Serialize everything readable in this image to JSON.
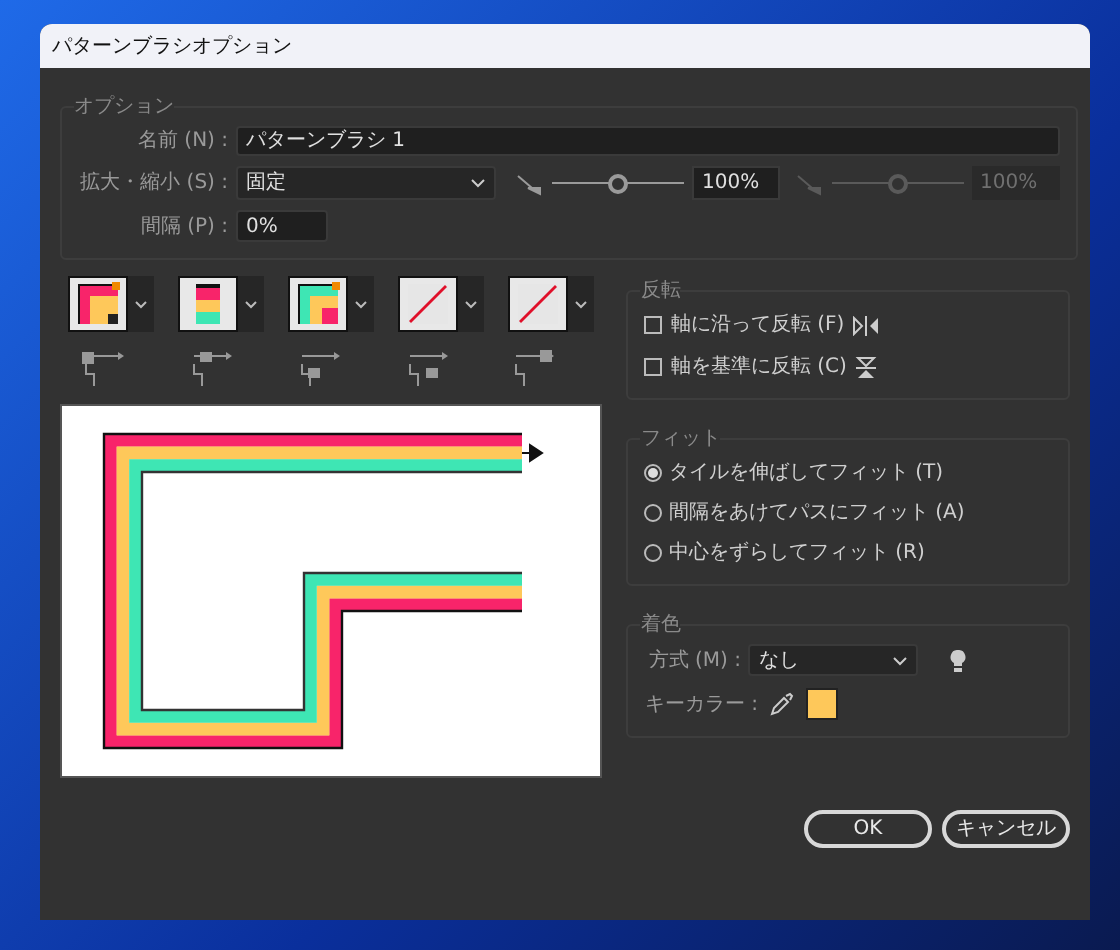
{
  "window": {
    "title": "パターンブラシオプション"
  },
  "options": {
    "legend": "オプション",
    "name": {
      "label": "名前 (N) :",
      "value": "パターンブラシ 1"
    },
    "scale": {
      "label": "拡大・縮小 (S) :",
      "value": "固定",
      "slider": {
        "level": 0.5,
        "value": "100%",
        "disabled": false
      },
      "slider_2": {
        "level": 0.5,
        "value": "100%",
        "disabled": true
      }
    },
    "spacing": {
      "label": "間隔 (P) :",
      "value": "0%"
    }
  },
  "tiles": [
    {
      "kind": "outer-corner"
    },
    {
      "kind": "side"
    },
    {
      "kind": "inner-corner"
    },
    {
      "kind": "none"
    },
    {
      "kind": "none"
    }
  ],
  "flip": {
    "legend": "反転",
    "options": [
      {
        "label": "軸に沿って反転 (F)",
        "checked": false,
        "kind": "along"
      },
      {
        "label": "軸を基準に反転 (C)",
        "checked": false,
        "kind": "across"
      }
    ]
  },
  "fit": {
    "legend": "フィット",
    "options": [
      {
        "label": "タイルを伸ばしてフィット (T)",
        "selected": true
      },
      {
        "label": "間隔をあけてパスにフィット (A)",
        "selected": false
      },
      {
        "label": "中心をずらしてフィット (R)",
        "selected": false
      }
    ]
  },
  "colorization": {
    "legend": "着色",
    "method": {
      "label": "方式 (M) :",
      "value": "なし"
    },
    "key_color": {
      "label": "キーカラー :",
      "color": "#fec85a"
    }
  },
  "buttons": [
    {
      "label": "OK"
    },
    {
      "label": "キャンセル"
    }
  ]
}
